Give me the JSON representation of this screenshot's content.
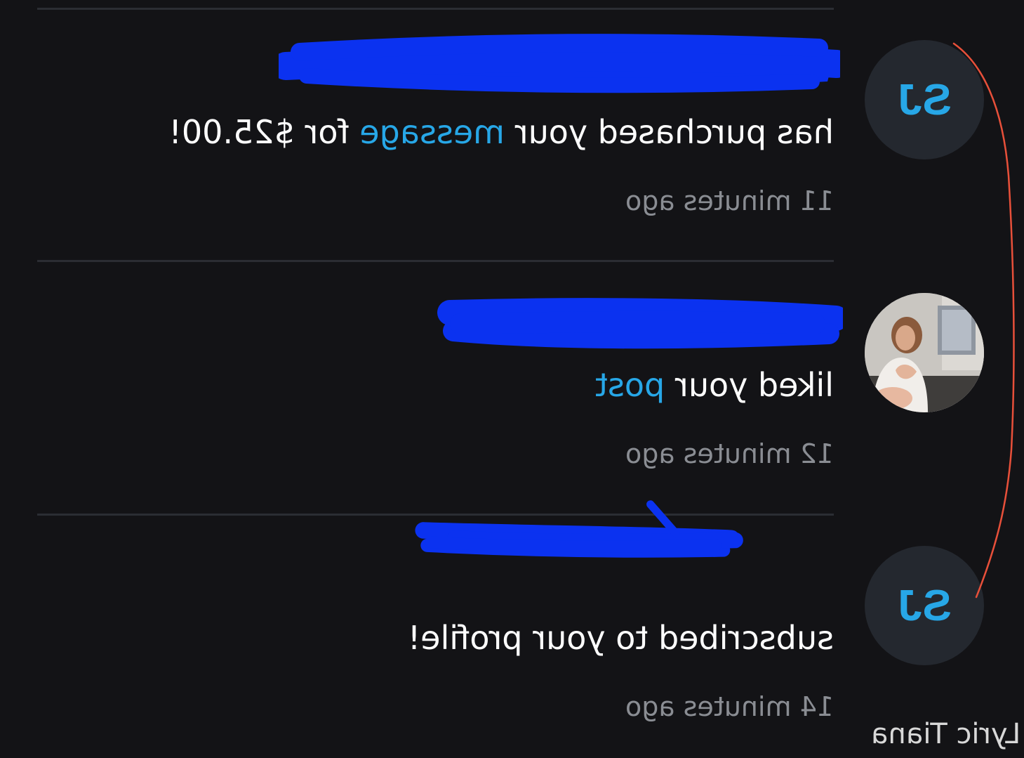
{
  "notifications": [
    {
      "avatar_initials": "SJ",
      "actor_name_redacted": true,
      "message_prefix": "has purchased your ",
      "message_link": "message",
      "message_suffix": " for $25.00!",
      "timestamp": "11 minutes ago"
    },
    {
      "avatar_photo": true,
      "actor_name_redacted": true,
      "message_prefix": "liked your ",
      "message_link": "post",
      "message_suffix": "",
      "timestamp": "12 minutes ago"
    },
    {
      "avatar_initials": "SJ",
      "actor_name_redacted": true,
      "message_prefix": "subscribed to your profile!",
      "message_link": "",
      "message_suffix": "",
      "timestamp": "14 minutes ago"
    }
  ],
  "watermark": "Lyric Tiana",
  "colors": {
    "background": "#131316",
    "link": "#27a7e7",
    "redaction": "#0b32f0",
    "annotation_line": "#e8503a",
    "timestamp": "#8a8d93"
  }
}
